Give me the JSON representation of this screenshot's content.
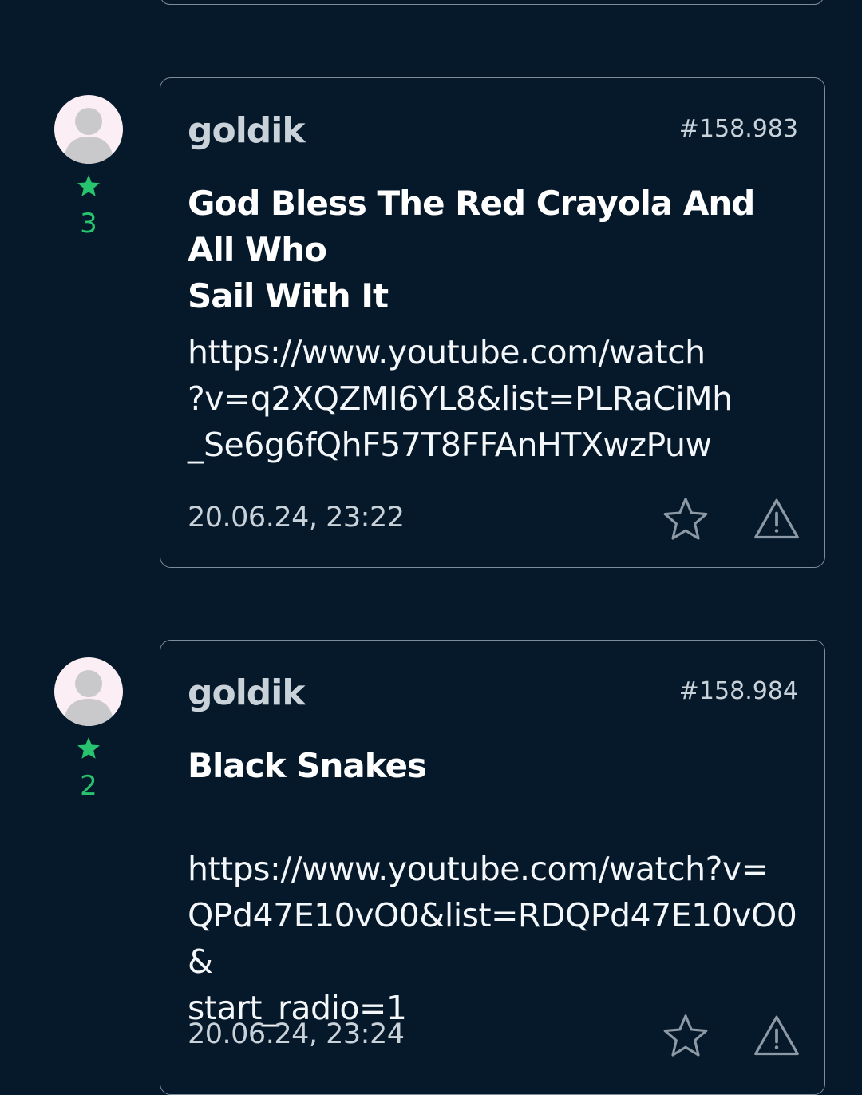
{
  "posts": [
    {
      "avatar_icon": "default-user-avatar",
      "rating": "3",
      "author": "goldik",
      "post_id": "#158.983",
      "title_line1": "God Bless The Red Crayola And All Who",
      "title_line2": "Sail With It",
      "link_lines": [
        "https://www.youtube.com/watch",
        "?v=q2XQZMI6YL8&list=PLRaCiMh",
        "_Se6g6fQhF57T8FFAnHTXwzPuw"
      ],
      "timestamp": "20.06.24, 23:22",
      "favorite_icon": "star-outline-icon",
      "report_icon": "warning-triangle-icon"
    },
    {
      "avatar_icon": "default-user-avatar",
      "rating": "2",
      "author": "goldik",
      "post_id": "#158.984",
      "title_line1": "Black Snakes",
      "title_line2": "",
      "link_lines": [
        "https://www.youtube.com/watch?v=",
        "QPd47E10vO0&list=RDQPd47E10vO0&",
        "start_radio=1"
      ],
      "timestamp": "20.06.24, 23:24",
      "favorite_icon": "star-outline-icon",
      "report_icon": "warning-triangle-icon"
    }
  ],
  "colors": {
    "background": "#06192a",
    "card_border": "#7d8c9a",
    "rating_green": "#27c36e",
    "muted_text": "#c9d1d9"
  }
}
